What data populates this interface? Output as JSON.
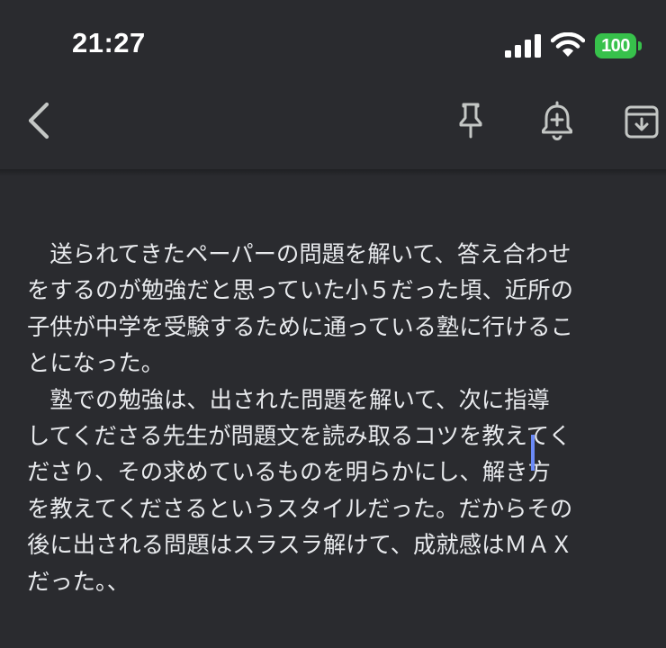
{
  "status_bar": {
    "time": "21:27",
    "battery": "100",
    "icons": [
      "signal-icon",
      "wifi-icon",
      "battery-icon"
    ],
    "battery_color": "#37c14b"
  },
  "toolbar": {
    "icons": [
      "back-icon",
      "pin-icon",
      "reminder-icon",
      "archive-icon"
    ]
  },
  "note": {
    "lines": [
      "　送られてきたペーパーの問題を解いて、答え合わせ",
      "をするのが勉強だと思っていた小５だった頃、近所の",
      "子供が中学を受験するために通っている塾に行けるこ",
      "とになった。",
      "　塾での勉強は、出された問題を解いて、次に指導",
      "してくださる先生が問題文を読み取るコツを教えてく",
      "ださり、その求めているものを明らかにし、解き方",
      "を教えてくださるというスタイルだった。だからその",
      "後に出される問題はスラスラ解けて、成就感はＭＡＸ",
      "だった。、"
    ],
    "text_color": "#e8eaed",
    "caret_color": "#6b8af7"
  },
  "colors": {
    "background": "#2a2b2f",
    "icon": "#c4c7c5"
  }
}
